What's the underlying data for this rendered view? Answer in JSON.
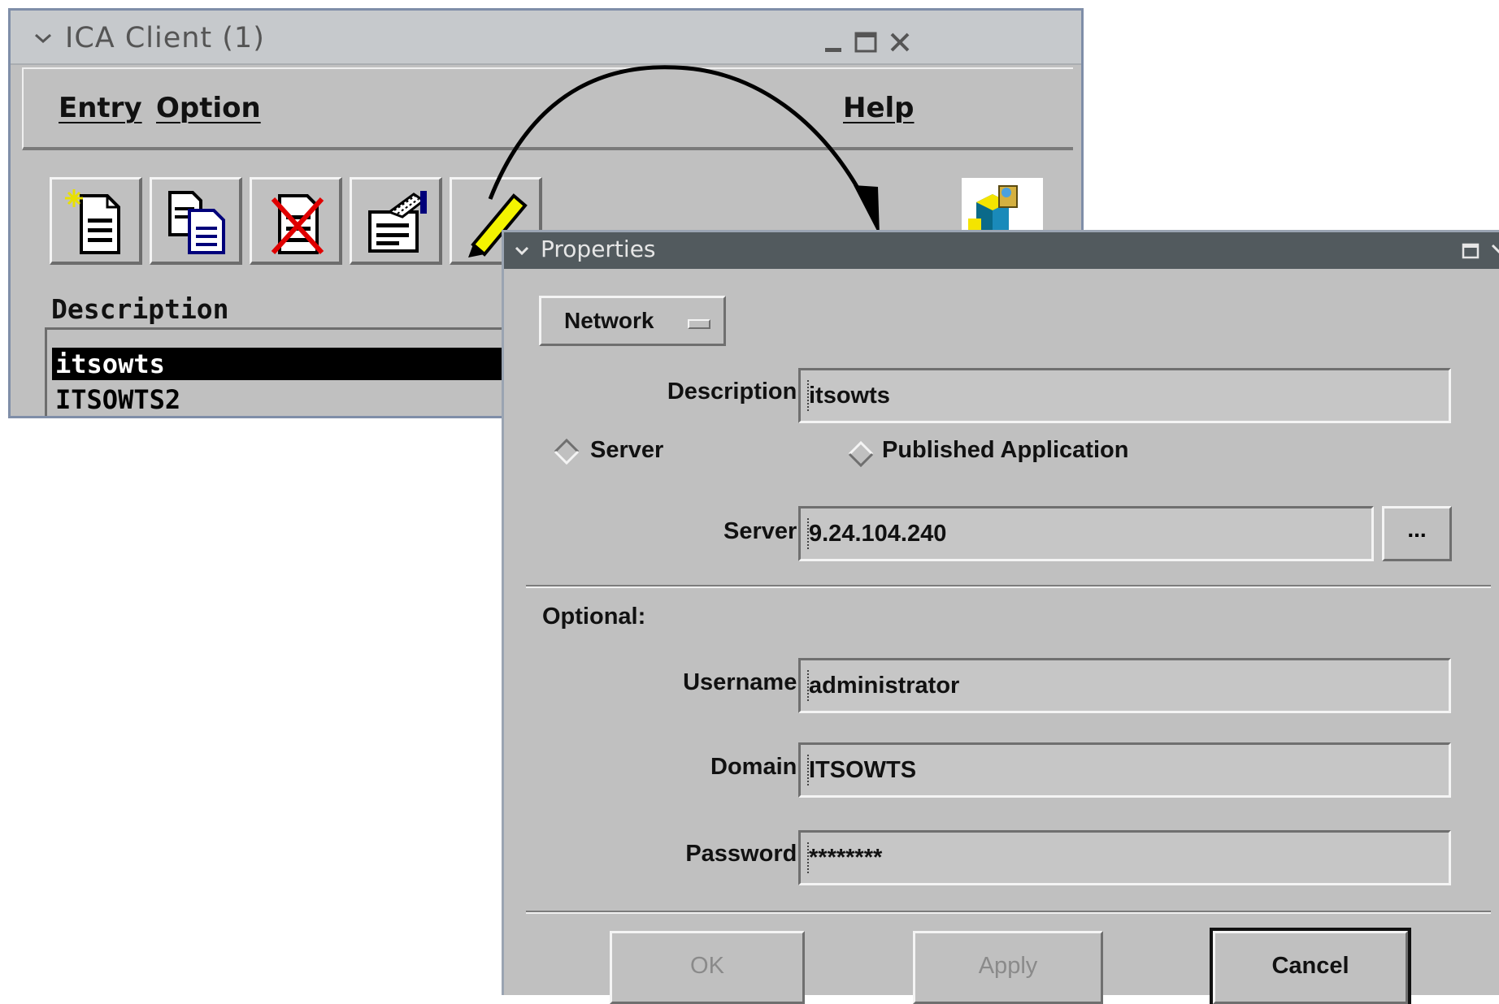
{
  "ica_window": {
    "title": "ICA Client (1)",
    "menu": {
      "entry": "Entry",
      "option": "Option",
      "help": "Help"
    },
    "toolbar_icons": [
      "new-entry-icon",
      "copy-entry-icon",
      "delete-entry-icon",
      "properties-icon",
      "edit-icon",
      "connect-icon"
    ],
    "description_heading": "Description",
    "entries": [
      "itsowts",
      "ITSOWTS2"
    ],
    "selected_entry": "itsowts"
  },
  "properties": {
    "title": "Properties",
    "page_selector": "Network",
    "description_label": "Description:",
    "description_value": "itsowts",
    "radio_server": "Server",
    "radio_published": "Published Application",
    "server_label": "Server:",
    "server_value": "9.24.104.240",
    "browse_label": "...",
    "optional_label": "Optional:",
    "username_label": "Username:",
    "username_value": "administrator",
    "domain_label": "Domain:",
    "domain_value": "ITSOWTS",
    "password_label": "Password:",
    "password_value": "********",
    "buttons": {
      "ok": "OK",
      "apply": "Apply",
      "cancel": "Cancel"
    }
  },
  "colors": {
    "dialog_titlebar": "#525a5e",
    "window_bg": "#c0c0c0",
    "selection": "#000000"
  }
}
